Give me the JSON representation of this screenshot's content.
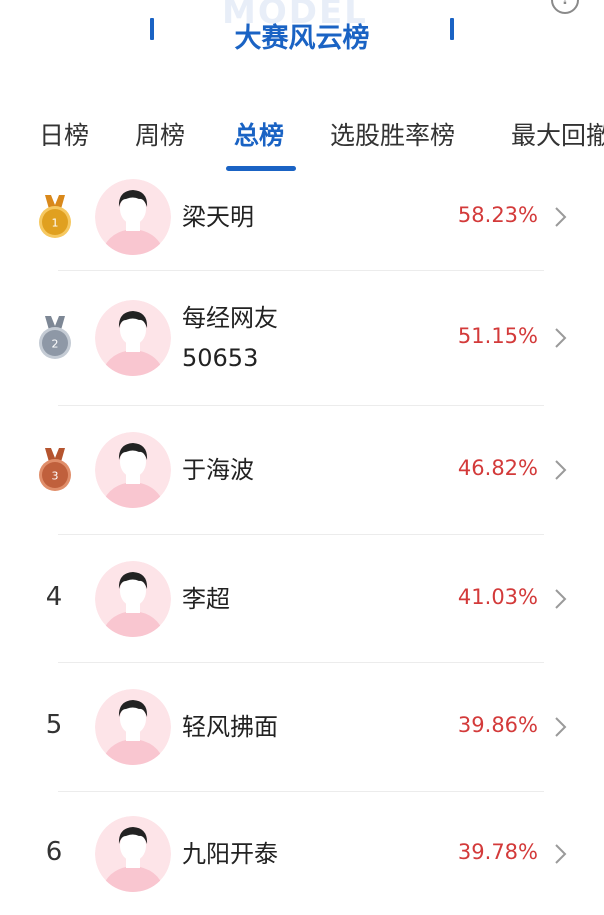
{
  "header": {
    "title": "大赛风云榜",
    "watermark": "MODEL",
    "info_icon": "info-icon"
  },
  "tabs": [
    {
      "label": "日榜",
      "active": false
    },
    {
      "label": "周榜",
      "active": false
    },
    {
      "label": "总榜",
      "active": true
    },
    {
      "label": "选股胜率榜",
      "active": false
    },
    {
      "label": "最大回撤",
      "active": false
    }
  ],
  "list": [
    {
      "rank": "1",
      "medal": "gold",
      "name_lines": [
        "梁天明"
      ],
      "rate": "58.23%"
    },
    {
      "rank": "2",
      "medal": "silver",
      "name_lines": [
        "每经网友",
        "50653"
      ],
      "rate": "51.15%"
    },
    {
      "rank": "3",
      "medal": "bronze",
      "name_lines": [
        "于海波"
      ],
      "rate": "46.82%"
    },
    {
      "rank": "4",
      "medal": "",
      "name_lines": [
        "李超"
      ],
      "rate": "41.03%"
    },
    {
      "rank": "5",
      "medal": "",
      "name_lines": [
        "轻风拂面"
      ],
      "rate": "39.86%"
    },
    {
      "rank": "6",
      "medal": "",
      "name_lines": [
        "九阳开泰"
      ],
      "rate": "39.78%"
    }
  ],
  "colors": {
    "accent": "#1a63c4",
    "rate": "#d33a3a",
    "gold": "#e0a020",
    "silver": "#8e98a6",
    "bronze": "#c0603c",
    "avatar_bg": "#fde4e8"
  }
}
